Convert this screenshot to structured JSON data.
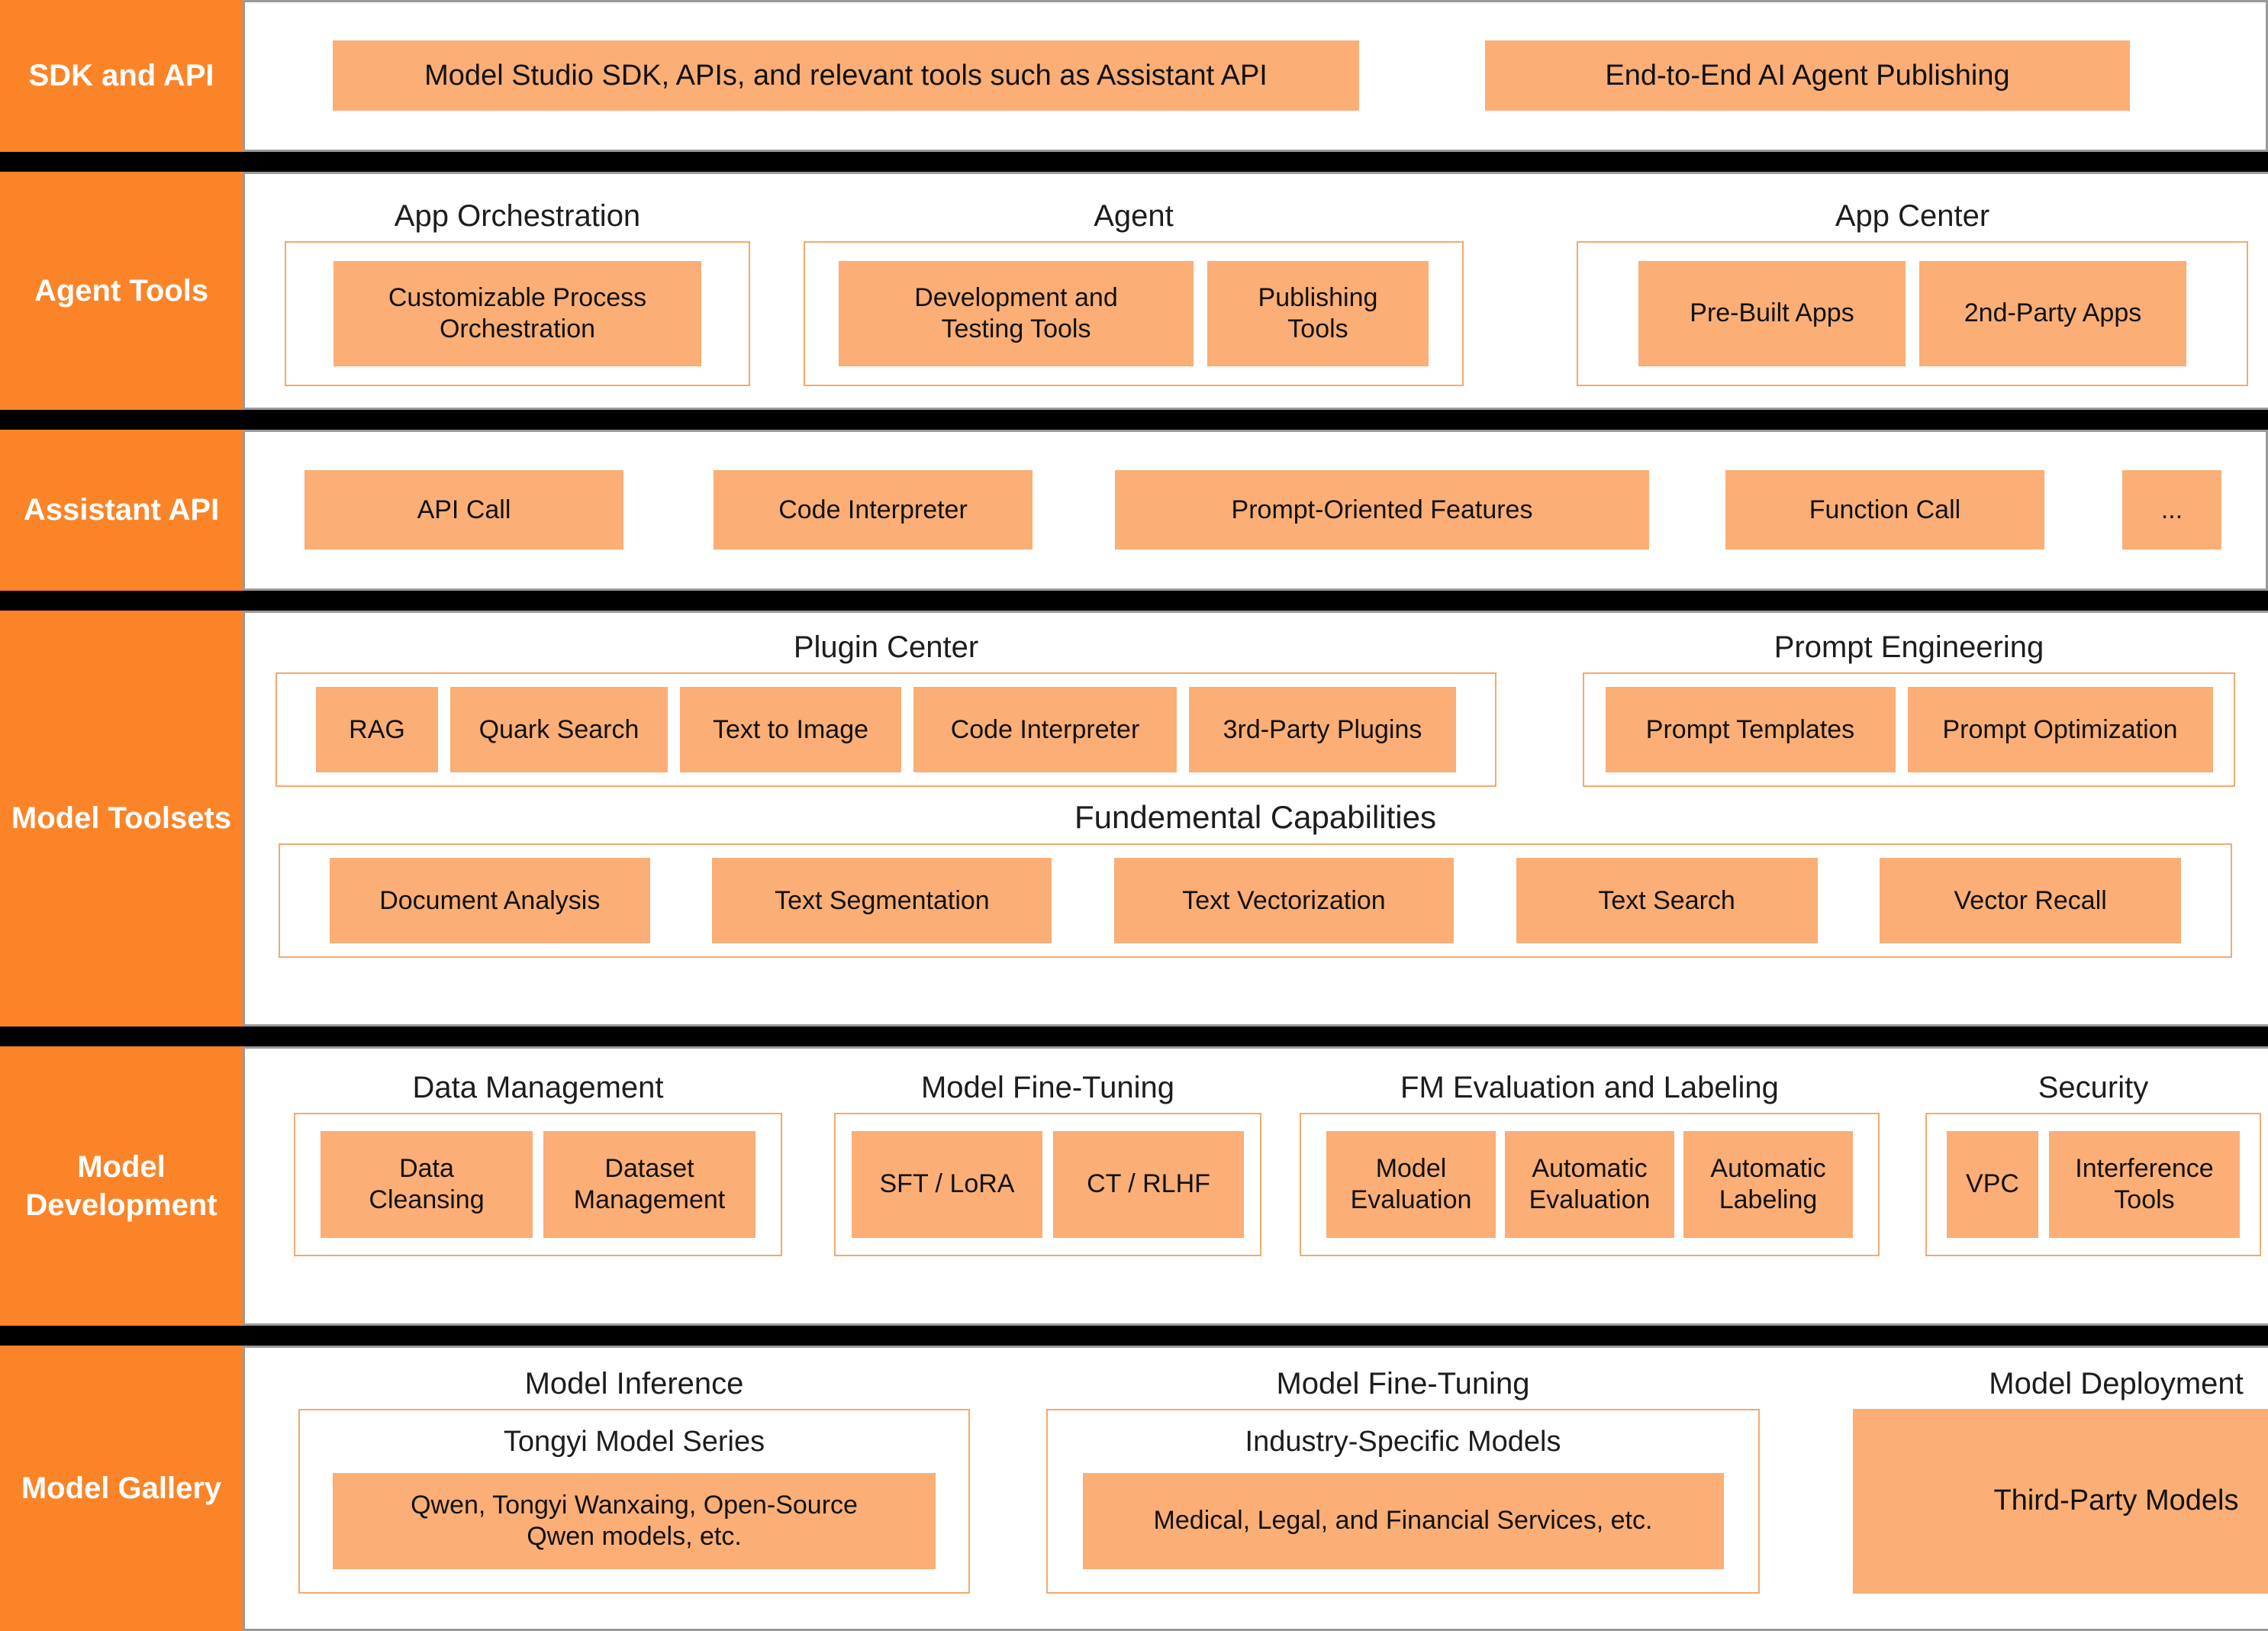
{
  "colors": {
    "layer_label_bg": "#FC8428",
    "layer_label_text": "#FFFFFF",
    "chip_bg": "#FBAE75",
    "chip_text": "#111111",
    "group_border": "#F6A96A",
    "body_border": "#9A9A9A",
    "band": "#000000",
    "page_bg": "#FFFFFF"
  },
  "layers": [
    {
      "label": "SDK and API",
      "chips": [
        {
          "label": "Model Studio SDK, APIs, and relevant tools such as Assistant API"
        },
        {
          "label": "End-to-End AI Agent Publishing"
        }
      ]
    },
    {
      "label": "Agent Tools",
      "groups": [
        {
          "caption": "App Orchestration",
          "chips": [
            {
              "label": "Customizable Process\nOrchestration"
            }
          ]
        },
        {
          "caption": "Agent",
          "chips": [
            {
              "label": "Development and\nTesting Tools"
            },
            {
              "label": "Publishing\nTools"
            }
          ]
        },
        {
          "caption": "App Center",
          "chips": [
            {
              "label": "Pre-Built Apps"
            },
            {
              "label": "2nd-Party Apps"
            }
          ]
        }
      ]
    },
    {
      "label": "Assistant API",
      "chips": [
        {
          "label": "API Call"
        },
        {
          "label": "Code Interpreter"
        },
        {
          "label": "Prompt-Oriented Features"
        },
        {
          "label": "Function Call"
        },
        {
          "label": "..."
        }
      ]
    },
    {
      "label": "Model\nToolsets",
      "groups": [
        {
          "caption": "Plugin Center",
          "chips": [
            {
              "label": "RAG"
            },
            {
              "label": "Quark Search"
            },
            {
              "label": "Text to Image"
            },
            {
              "label": "Code Interpreter"
            },
            {
              "label": "3rd-Party Plugins"
            }
          ]
        },
        {
          "caption": "Prompt Engineering",
          "chips": [
            {
              "label": "Prompt Templates"
            },
            {
              "label": "Prompt Optimization"
            }
          ]
        },
        {
          "caption": "Fundemental Capabilities",
          "chips": [
            {
              "label": "Document Analysis"
            },
            {
              "label": "Text Segmentation"
            },
            {
              "label": "Text Vectorization"
            },
            {
              "label": "Text Search"
            },
            {
              "label": "Vector Recall"
            }
          ]
        }
      ]
    },
    {
      "label": "Model\nDevelopment",
      "groups": [
        {
          "caption": "Data Management",
          "chips": [
            {
              "label": "Data\nCleansing"
            },
            {
              "label": "Dataset\nManagement"
            }
          ]
        },
        {
          "caption": "Model Fine-Tuning",
          "chips": [
            {
              "label": "SFT / LoRA"
            },
            {
              "label": "CT / RLHF"
            }
          ]
        },
        {
          "caption": "FM Evaluation and Labeling",
          "chips": [
            {
              "label": "Model\nEvaluation"
            },
            {
              "label": "Automatic\nEvaluation"
            },
            {
              "label": "Automatic\nLabeling"
            }
          ]
        },
        {
          "caption": "Security",
          "chips": [
            {
              "label": "VPC"
            },
            {
              "label": "Interference\nTools"
            }
          ]
        }
      ]
    },
    {
      "label": "Model Gallery",
      "groups": [
        {
          "caption": "Model Inference",
          "subcaption": "Tongyi Model Series",
          "chips": [
            {
              "label": "Qwen, Tongyi Wanxaing, Open-Source\nQwen models, etc."
            }
          ]
        },
        {
          "caption": "Model Fine-Tuning",
          "subcaption": "Industry-Specific Models",
          "chips": [
            {
              "label": "Medical, Legal, and Financial Services, etc."
            }
          ]
        },
        {
          "caption": "Model Deployment",
          "chips": [
            {
              "label": "Third-Party Models"
            }
          ]
        }
      ]
    }
  ]
}
